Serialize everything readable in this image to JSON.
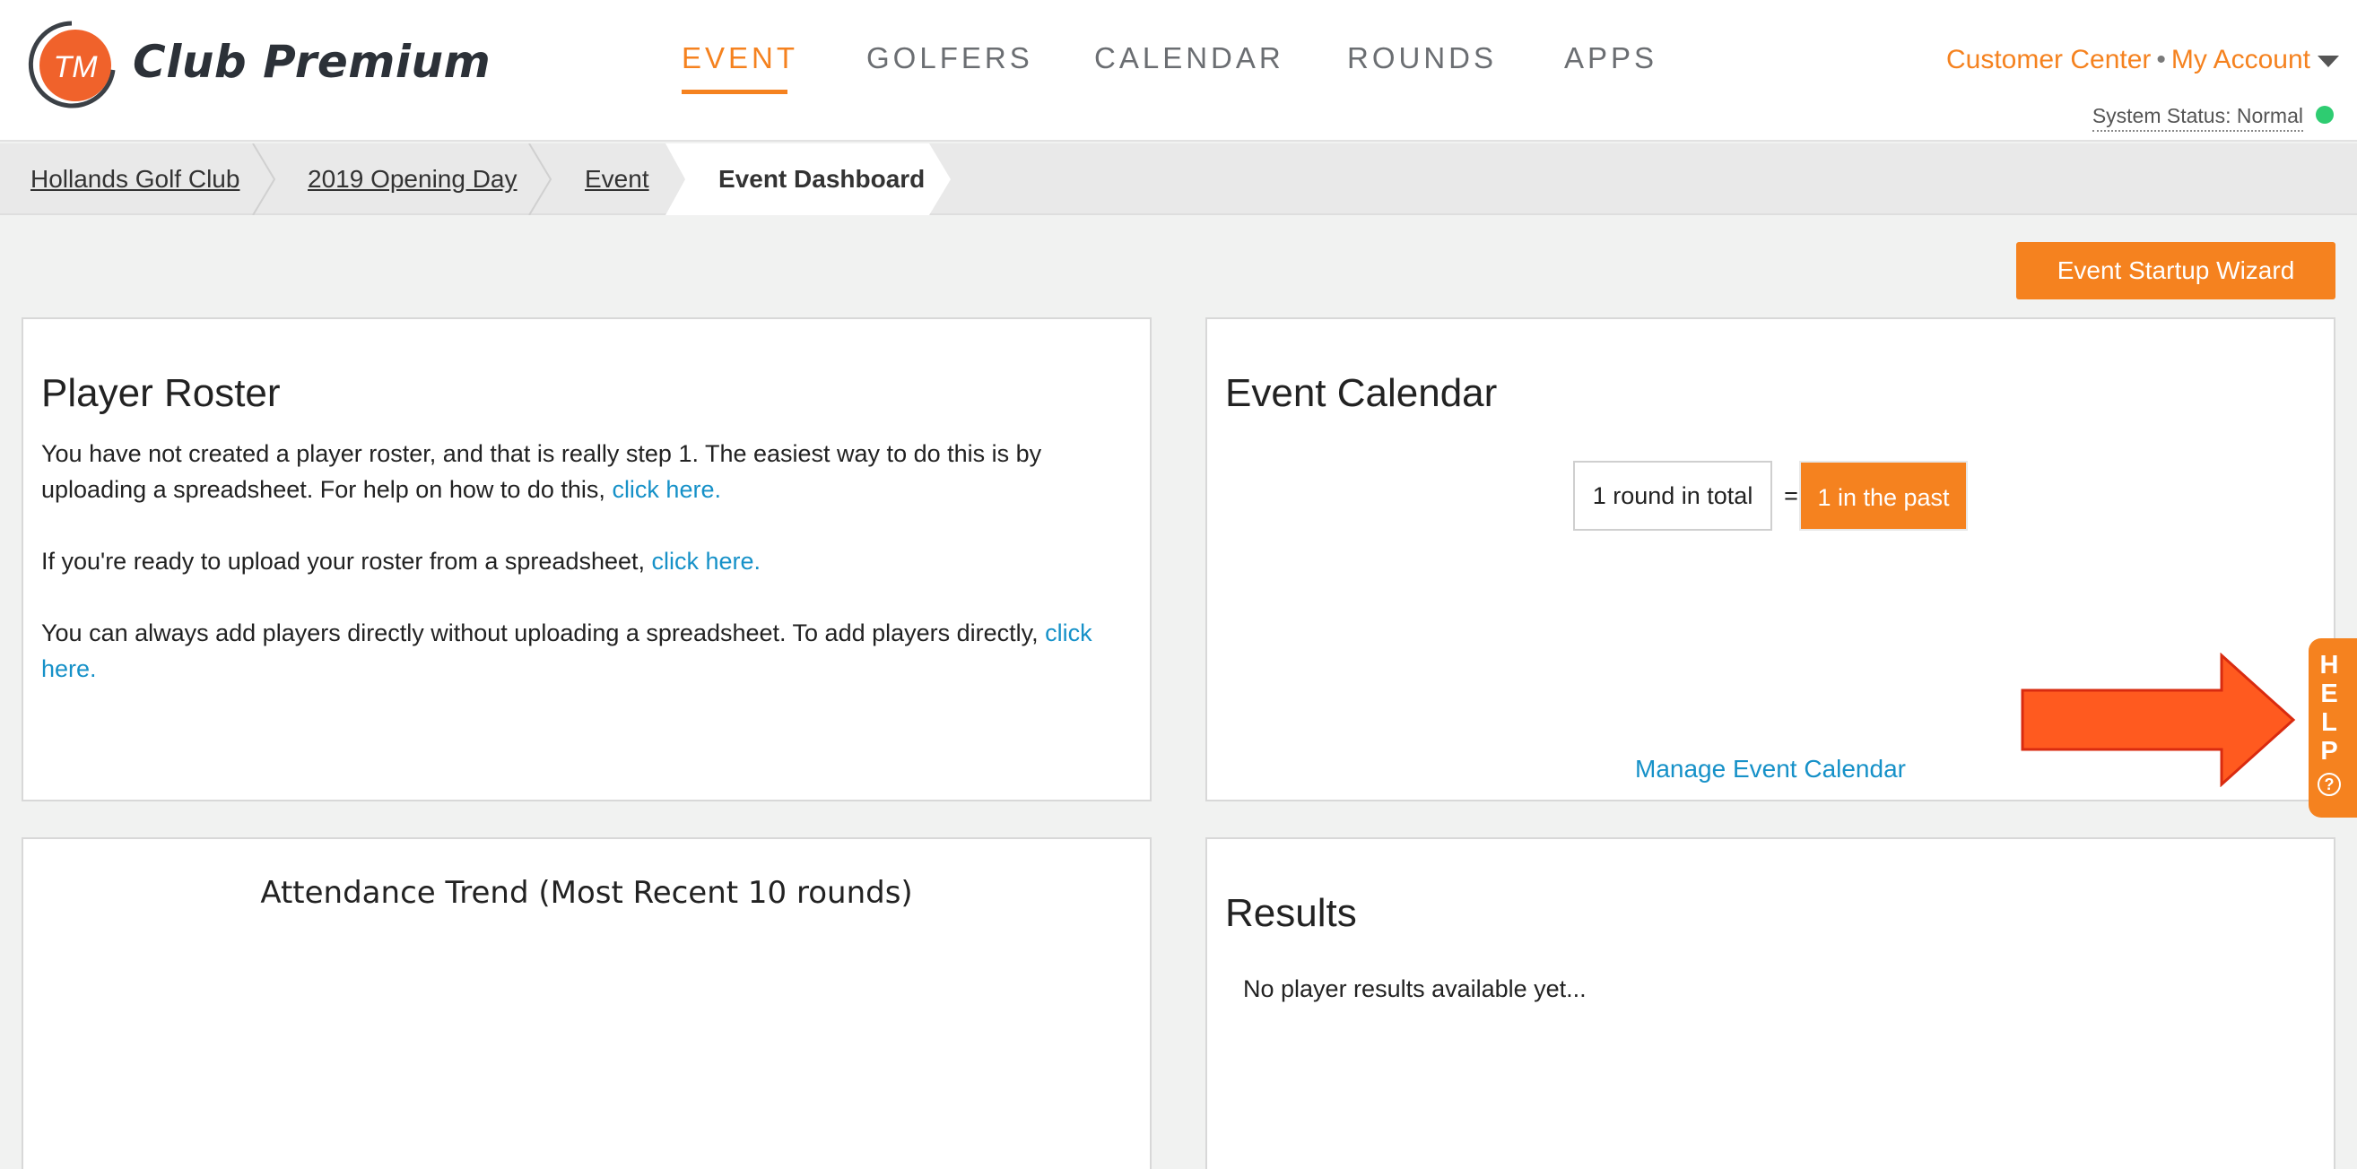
{
  "header": {
    "logo_text": "TM",
    "brand": "Club Premium",
    "nav": [
      {
        "label": "EVENT"
      },
      {
        "label": "GOLFERS"
      },
      {
        "label": "CALENDAR"
      },
      {
        "label": "ROUNDS"
      },
      {
        "label": "APPS"
      }
    ],
    "customer_center": "Customer Center",
    "separator": "•",
    "my_account": "My Account",
    "system_status": "System Status: Normal"
  },
  "breadcrumb": [
    "Hollands Golf Club",
    "2019 Opening Day",
    "Event",
    "Event Dashboard"
  ],
  "wizard_button": "Event Startup Wizard",
  "roster": {
    "title": "Player Roster",
    "p1_text": "You have not created a player roster, and that is really step 1. The easiest way to do this is by uploading a spreadsheet. For help on how to do this, ",
    "p1_link": "click here.",
    "p2_text": "If you're ready to upload your roster from a spreadsheet, ",
    "p2_link": "click here.",
    "p3_text": "You can always add players directly without uploading a spreadsheet. To add players directly, ",
    "p3_link": "click here."
  },
  "calendar": {
    "title": "Event Calendar",
    "total": "1 round in total",
    "equals": "=",
    "past": "1 in the past",
    "manage": "Manage Event Calendar"
  },
  "attendance": {
    "title": "Attendance Trend (Most Recent 10 rounds)"
  },
  "results": {
    "title": "Results",
    "empty": "No player results available yet..."
  },
  "help": {
    "letters": [
      "H",
      "E",
      "L",
      "P"
    ],
    "q": "?"
  },
  "colors": {
    "accent": "#f5821f",
    "link": "#1691c8",
    "status_ok": "#2ecc71",
    "arrow": "#ff5a1f"
  },
  "icons": [
    "tm-logo-icon",
    "caret-down-icon",
    "status-dot-icon",
    "arrow-right-icon",
    "help-question-icon"
  ]
}
